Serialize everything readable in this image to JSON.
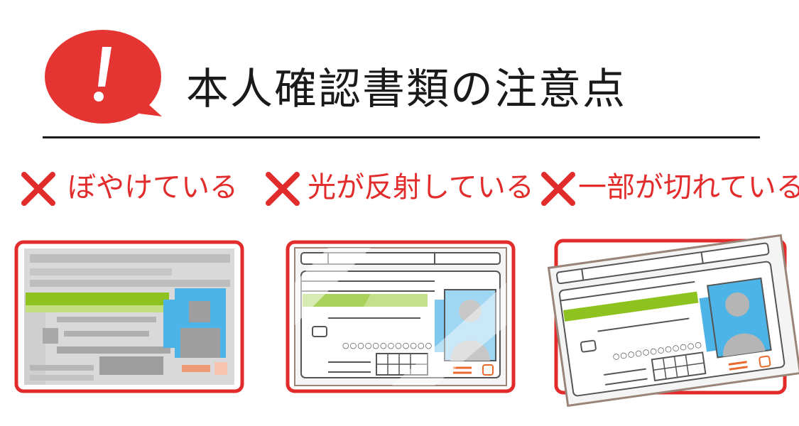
{
  "header": {
    "title": "本人確認書類の注意点",
    "alert_icon": "exclamation-speech-bubble-icon",
    "accent_color": "#e53532"
  },
  "examples": [
    {
      "label": "ぼやけている",
      "status_icon": "cross-icon",
      "card_digits": ""
    },
    {
      "label": "光が反射している",
      "status_icon": "cross-icon",
      "card_digits": "○○○○○○○○○○○○"
    },
    {
      "label": "一部が切れている",
      "status_icon": "cross-icon",
      "card_digits": "○○○○○○○○○○○○"
    }
  ],
  "colors": {
    "label_red": "#e22c2c",
    "card_green": "#8dc21f",
    "photo_blue": "#4cb4e6"
  }
}
